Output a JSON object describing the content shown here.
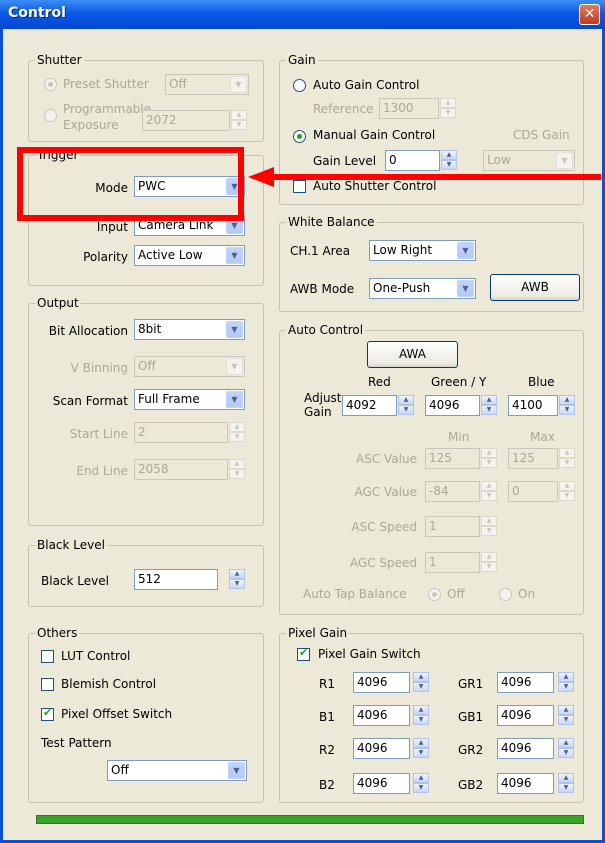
{
  "window": {
    "title": "Control",
    "close": "✕"
  },
  "shutter": {
    "legend": "Shutter",
    "preset_label": "Preset Shutter",
    "preset_value": "Off",
    "programmable_label_1": "Programmable",
    "programmable_label_2": "Exposure",
    "programmable_value": "2072"
  },
  "trigger": {
    "legend": "Trigger",
    "mode_label": "Mode",
    "mode_value": "PWC",
    "input_label": "Input",
    "input_value": "Camera Link",
    "polarity_label": "Polarity",
    "polarity_value": "Active Low"
  },
  "output": {
    "legend": "Output",
    "bit_allocation_label": "Bit Allocation",
    "bit_allocation_value": "8bit",
    "v_binning_label": "V Binning",
    "v_binning_value": "Off",
    "scan_format_label": "Scan Format",
    "scan_format_value": "Full Frame",
    "start_line_label": "Start Line",
    "start_line_value": "2",
    "end_line_label": "End Line",
    "end_line_value": "2058"
  },
  "black_level": {
    "legend": "Black Level",
    "label": "Black Level",
    "value": "512"
  },
  "others": {
    "legend": "Others",
    "lut_control": "LUT Control",
    "blemish_control": "Blemish Control",
    "pixel_offset_switch": "Pixel Offset Switch",
    "test_pattern_label": "Test Pattern",
    "test_pattern_value": "Off"
  },
  "gain": {
    "legend": "Gain",
    "auto_gain_label": "Auto Gain Control",
    "reference_label": "Reference",
    "reference_value": "1300",
    "manual_gain_label": "Manual Gain Control",
    "cds_gain_label": "CDS Gain",
    "gain_level_label": "Gain Level",
    "gain_level_value": "0",
    "cds_gain_value": "Low",
    "auto_shutter_label": "Auto Shutter Control"
  },
  "white_balance": {
    "legend": "White Balance",
    "ch1_area_label": "CH.1 Area",
    "ch1_area_value": "Low Right",
    "awb_mode_label": "AWB Mode",
    "awb_mode_value": "One-Push",
    "awb_button": "AWB"
  },
  "auto_control": {
    "legend": "Auto Control",
    "awa_button": "AWA",
    "adjust_gain_label_1": "Adjust",
    "adjust_gain_label_2": "Gain",
    "col_red": "Red",
    "col_green": "Green / Y",
    "col_blue": "Blue",
    "red_value": "4092",
    "green_value": "4096",
    "blue_value": "4100",
    "min_label": "Min",
    "max_label": "Max",
    "asc_value_label": "ASC Value",
    "asc_min": "125",
    "asc_max": "125",
    "agc_value_label": "AGC Value",
    "agc_min": "-84",
    "agc_max": "0",
    "asc_speed_label": "ASC Speed",
    "asc_speed": "1",
    "agc_speed_label": "AGC Speed",
    "agc_speed": "1",
    "auto_tap_label": "Auto Tap Balance",
    "off_label": "Off",
    "on_label": "On"
  },
  "pixel_gain": {
    "legend": "Pixel Gain",
    "switch_label": "Pixel Gain Switch",
    "r1_label": "R1",
    "r1_value": "4096",
    "gr1_label": "GR1",
    "gr1_value": "4096",
    "b1_label": "B1",
    "b1_value": "4096",
    "gb1_label": "GB1",
    "gb1_value": "4096",
    "r2_label": "R2",
    "r2_value": "4096",
    "gr2_label": "GR2",
    "gr2_value": "4096",
    "b2_label": "B2",
    "b2_value": "4096",
    "gb2_label": "GB2",
    "gb2_value": "4096"
  },
  "progress": {
    "fraction": 1.0
  },
  "colors": {
    "highlight": "#ff0000",
    "title_bar": "#0a5ae6",
    "dialog_bg": "#ece9d8",
    "progress": "#3aa42a"
  }
}
